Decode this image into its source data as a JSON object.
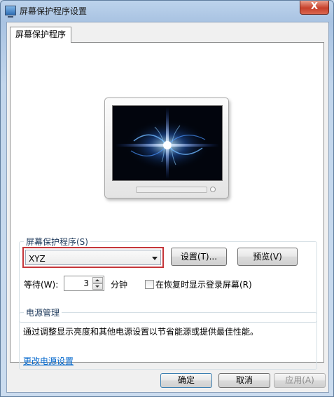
{
  "window": {
    "title": "屏幕保护程序设置",
    "close_glyph": "X"
  },
  "tab": {
    "label": "屏幕保护程序"
  },
  "screen_saver": {
    "group_title": "屏幕保护程序(S)",
    "selected": "XYZ",
    "settings_button": "设置(T)...",
    "preview_button": "预览(V)",
    "wait_label": "等待(W):",
    "wait_value": "3",
    "minutes_label": "分钟",
    "resume_label": "在恢复时显示登录屏幕(R)",
    "resume_checked": false,
    "highlight_color": "#c5363a"
  },
  "power": {
    "group_title": "电源管理",
    "description": "通过调整显示亮度和其他电源设置以节省能源或提供最佳性能。",
    "link": "更改电源设置"
  },
  "footer": {
    "ok": "确定",
    "cancel": "取消",
    "apply": "应用(A)"
  }
}
